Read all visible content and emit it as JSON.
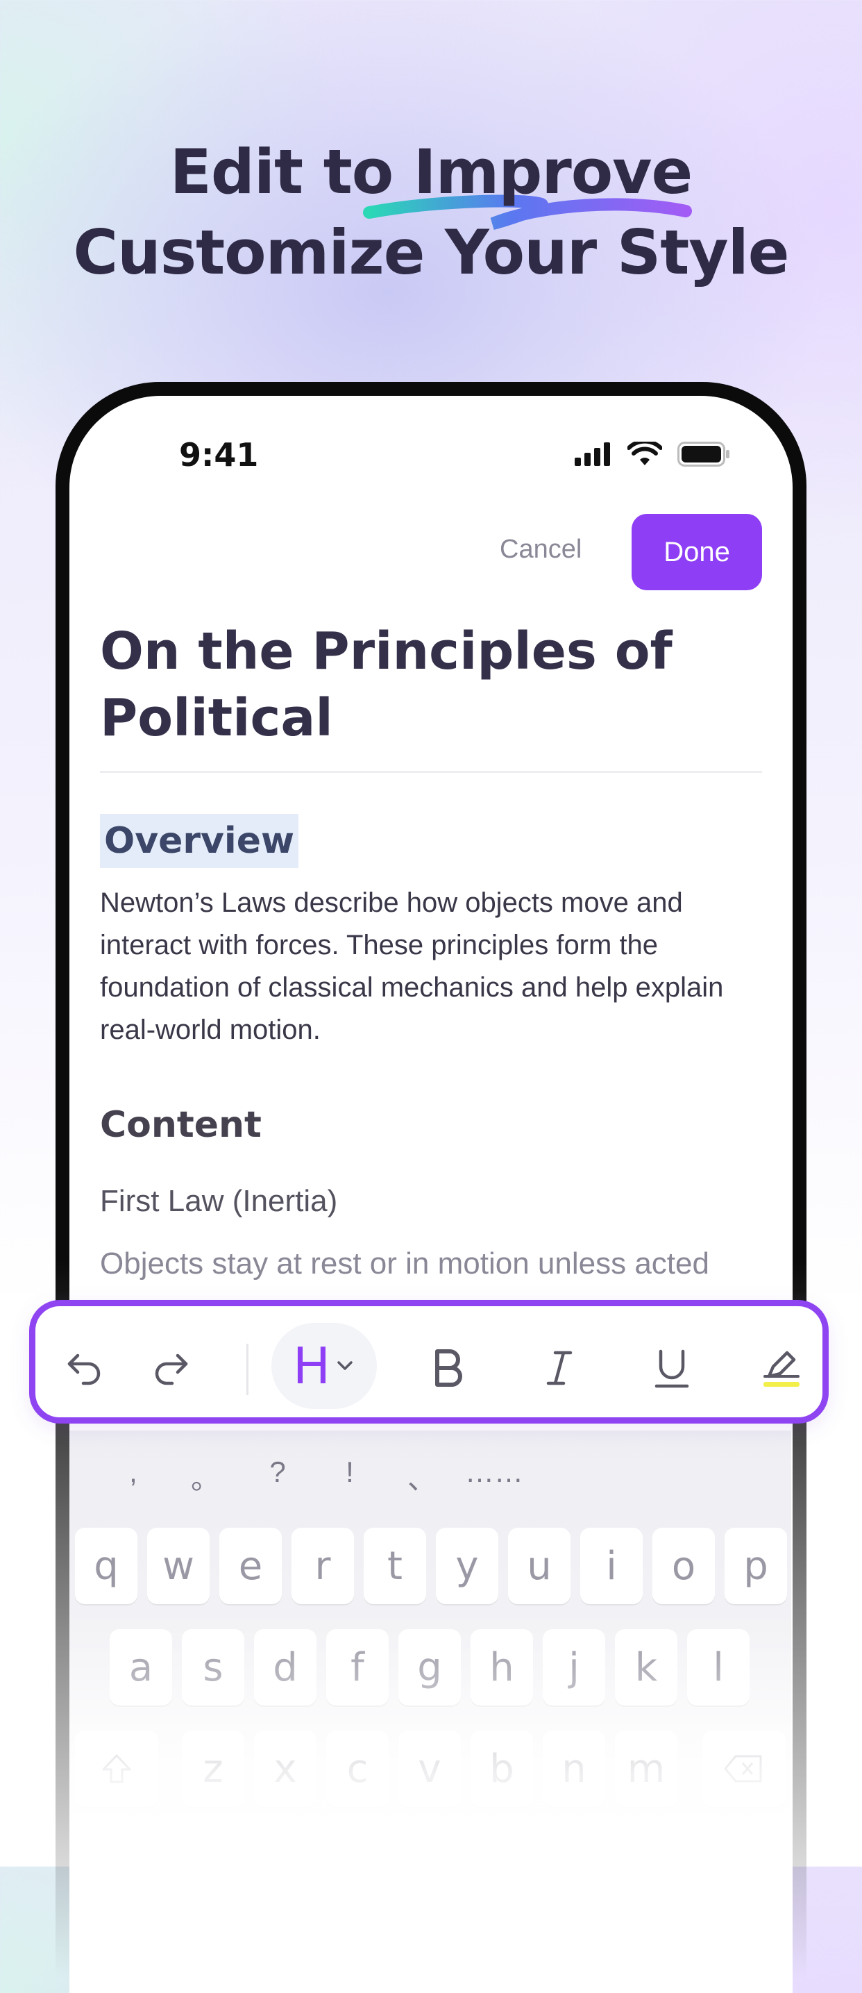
{
  "headline": {
    "line1": "Edit to Improve",
    "line2": "Customize Your Style",
    "accent_colors": [
      "#2ad8b6",
      "#8d4cf4"
    ]
  },
  "status_bar": {
    "time": "9:41",
    "icons": [
      "signal-icon",
      "wifi-icon",
      "battery-icon"
    ]
  },
  "editor": {
    "cancel_label": "Cancel",
    "done_label": "Done",
    "title": "On the Principles of Political",
    "section1_heading": "Overview",
    "section1_body": "Newton’s Laws describe how objects move and interact with forces. These principles form the foundation of classical mechanics and help explain real-world motion.",
    "section2_heading": "Content",
    "subheading": "First Law (Inertia)",
    "body_partial": "Objects stay at rest or in motion unless acted"
  },
  "toolbar": {
    "tools": [
      "undo-icon",
      "redo-icon",
      "heading-icon",
      "bold-icon",
      "italic-icon",
      "underline-icon",
      "highlight-icon"
    ],
    "heading_letter": "H",
    "accent_color": "#8e3ff5",
    "highlight_color": "#f2ee4a"
  },
  "keyboard": {
    "punctuation": [
      ",",
      "。",
      "?",
      "!",
      "、",
      "……"
    ],
    "row1": [
      "q",
      "w",
      "e",
      "r",
      "t",
      "y",
      "u",
      "i",
      "o",
      "p"
    ],
    "row2": [
      "a",
      "s",
      "d",
      "f",
      "g",
      "h",
      "j",
      "k",
      "l"
    ],
    "row3": [
      "z",
      "x",
      "c",
      "v",
      "b",
      "n",
      "m"
    ]
  }
}
